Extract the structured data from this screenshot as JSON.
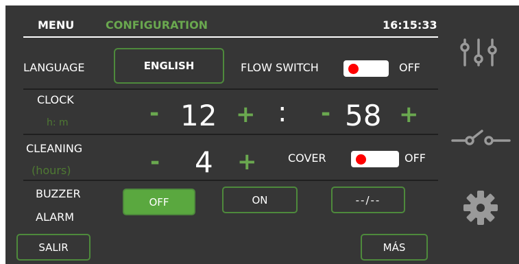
{
  "header": {
    "menu": "MENU",
    "section": "CONFIGURATION",
    "time": "16:15:33"
  },
  "language": {
    "label": "LANGUAGE",
    "value": "ENGLISH"
  },
  "flow_switch": {
    "label": "FLOW SWITCH",
    "state": "OFF"
  },
  "clock": {
    "label": "CLOCK",
    "unit": "h: m",
    "hours": "12",
    "minutes": "58",
    "separator": ":",
    "minus": "-",
    "plus": "+"
  },
  "cleaning": {
    "label": "CLEANING",
    "unit": "(hours)",
    "value": "4",
    "minus": "-",
    "plus": "+"
  },
  "cover": {
    "label": "COVER",
    "state": "OFF"
  },
  "buzzer": {
    "label_line1": "BUZZER",
    "label_line2": "ALARM",
    "options": [
      "OFF",
      "ON",
      "--/--"
    ],
    "selected": "OFF"
  },
  "footer": {
    "exit": "SALIR",
    "more": "MÁS"
  },
  "sidebar": {
    "icons": [
      "sliders-icon",
      "switch-icon",
      "gear-icon"
    ]
  },
  "colors": {
    "background": "#363636",
    "accent": "#5aa83f",
    "border": "#4e8a3c",
    "toggle_knob": "#ff0000"
  }
}
